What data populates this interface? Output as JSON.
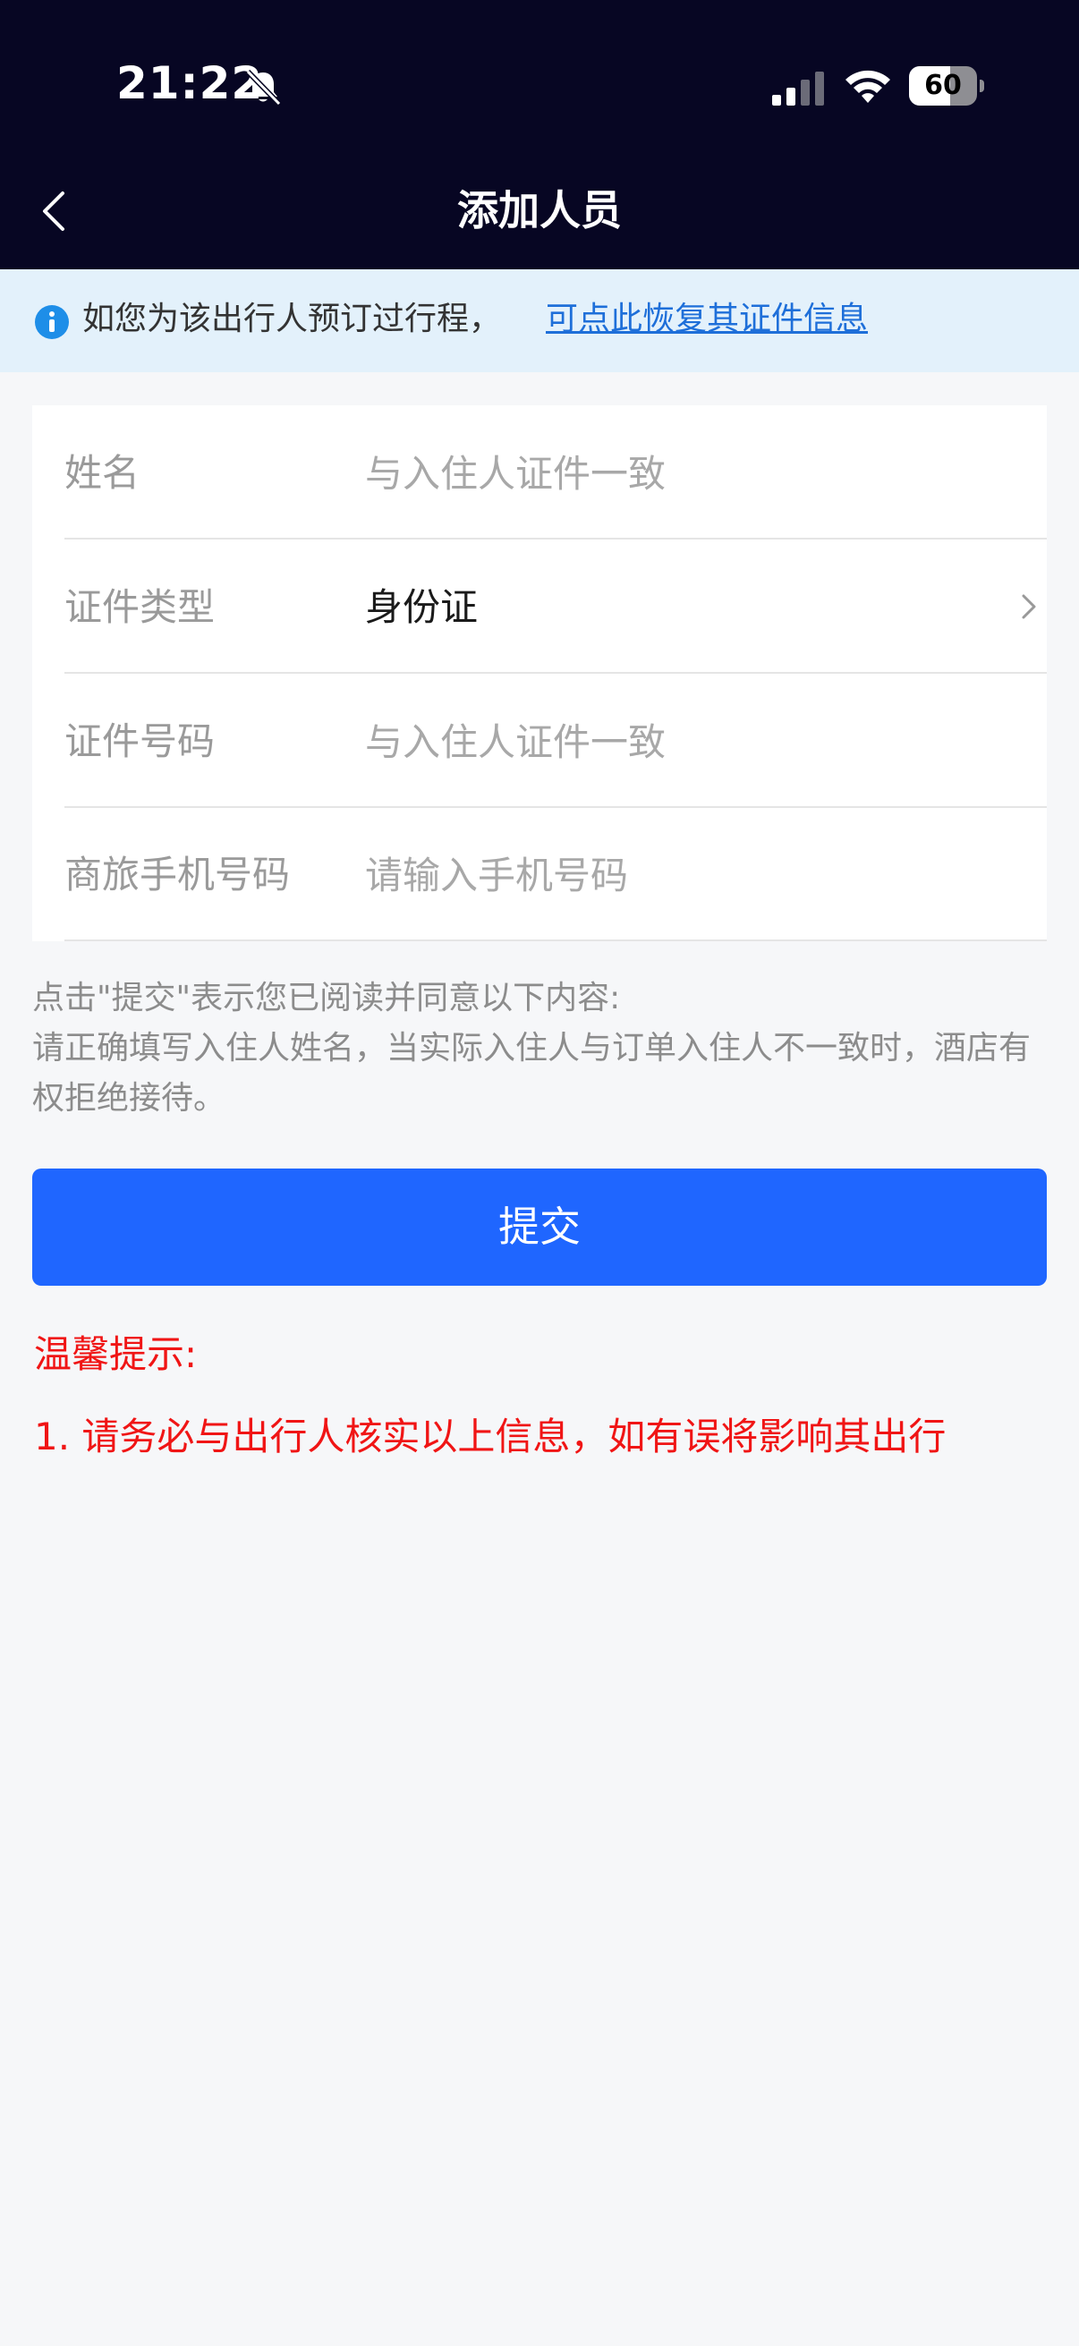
{
  "status_bar": {
    "time": "21:22",
    "battery_percent": 60,
    "battery_label": "60",
    "icons": [
      "bell-off-icon",
      "cell-signal-icon",
      "wifi-icon",
      "battery-icon"
    ],
    "background_color": "#070623"
  },
  "nav": {
    "title": "添加人员",
    "back_icon": "chevron-left-icon"
  },
  "notice": {
    "icon": "info-icon",
    "text": "如您为该出行人预订过行程，",
    "link_text": "可点此恢复其证件信息",
    "link_color": "#1e6fd9"
  },
  "form": {
    "rows": [
      {
        "label": "姓名",
        "placeholder": "与入住人证件一致"
      },
      {
        "label": "证件类型",
        "value": "身份证",
        "icon": "chevron-right-icon"
      },
      {
        "label": "证件号码",
        "placeholder": "与入住人证件一致"
      },
      {
        "label": "商旅手机号码",
        "placeholder": "请输入手机号码"
      }
    ]
  },
  "agreement": {
    "line1": "点击\"提交\"表示您已阅读并同意以下内容:",
    "line2": "请正确填写入住人姓名，当实际入住人与订单入住人不一致时，酒店有权拒绝接待。"
  },
  "submit": {
    "label": "提交",
    "color": "#1f66ff"
  },
  "tips": {
    "title": "温馨提示:",
    "items": [
      "1. 请务必与出行人核实以上信息，如有误将影响其出行"
    ],
    "color": "#f01515"
  }
}
